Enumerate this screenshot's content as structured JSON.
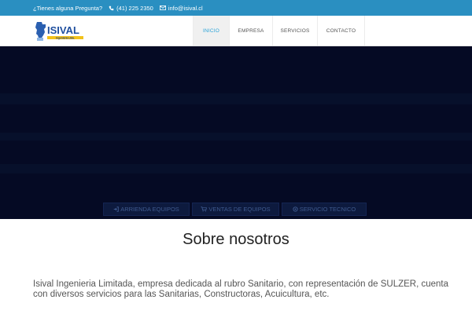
{
  "topbar": {
    "question": "¿Tienes alguna Pregunta?",
    "phone": "(41) 225 2350",
    "email": "info@isival.cl",
    "phone_icon": "phone-icon",
    "email_icon": "envelope-icon"
  },
  "logo": {
    "name": "ISIVAL",
    "subtitle": "Ingeniería Ltda."
  },
  "nav": {
    "items": [
      {
        "label": "INICIO",
        "active": true
      },
      {
        "label": "EMPRESA",
        "active": false
      },
      {
        "label": "SERVICIOS",
        "active": false
      },
      {
        "label": "CONTACTO",
        "active": false
      }
    ]
  },
  "hero": {
    "buttons": [
      {
        "label": "ARRIENDA EQUIPOS",
        "icon": "sign-in-icon"
      },
      {
        "label": "VENTAS DE EQUIPOS",
        "icon": "cart-icon"
      },
      {
        "label": "SERVICIO TECNICO",
        "icon": "settings-icon"
      }
    ]
  },
  "about": {
    "title": "Sobre nosotros",
    "text": "Isival Ingenieria Limitada, empresa dedicada al rubro Sanitario, con representación de SULZER, cuenta con diversos servicios para las Sanitarias, Constructoras, Acuicultura, etc."
  },
  "colors": {
    "topbar": "#2a8fc1",
    "hero": "#050a24",
    "nav_active": "#2aa3d8",
    "cta_bg": "#0d1a3e",
    "cta_text": "#3f5a8e"
  }
}
